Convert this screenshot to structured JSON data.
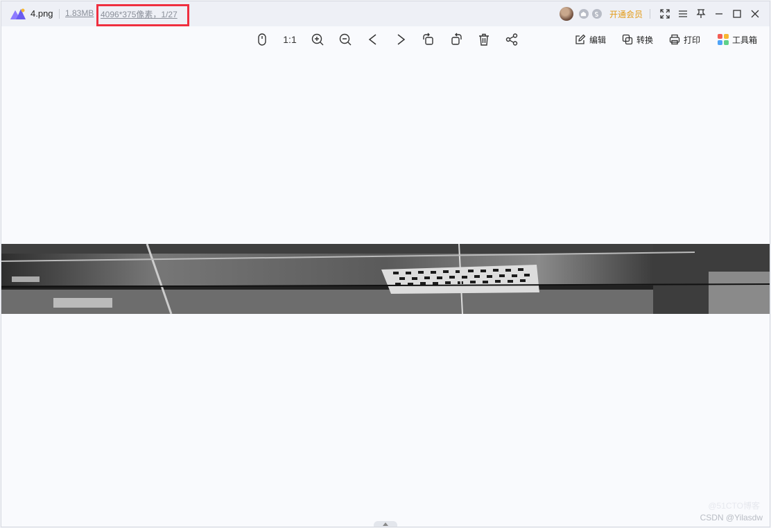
{
  "title_bar": {
    "file_name": "4.png",
    "file_size": "1.83MB",
    "image_info": "4096*375像素，1/27",
    "vip_label": "开通会员"
  },
  "toolbar": {
    "ratio_label": "1:1",
    "actions": [
      {
        "label": "编辑",
        "icon": "edit-icon"
      },
      {
        "label": "转换",
        "icon": "convert-icon"
      },
      {
        "label": "打印",
        "icon": "print-icon"
      },
      {
        "label": "工具箱",
        "icon": "toolbox-icon"
      }
    ]
  },
  "watermarks": {
    "blog": "@51CTO博客",
    "csdn": "CSDN @Yilasdw"
  },
  "colors": {
    "highlight": "#ef2f3f",
    "vip": "#e39a16",
    "toolbox": [
      "#f25c54",
      "#f7b731",
      "#4fa3f7",
      "#5fd18a"
    ]
  }
}
